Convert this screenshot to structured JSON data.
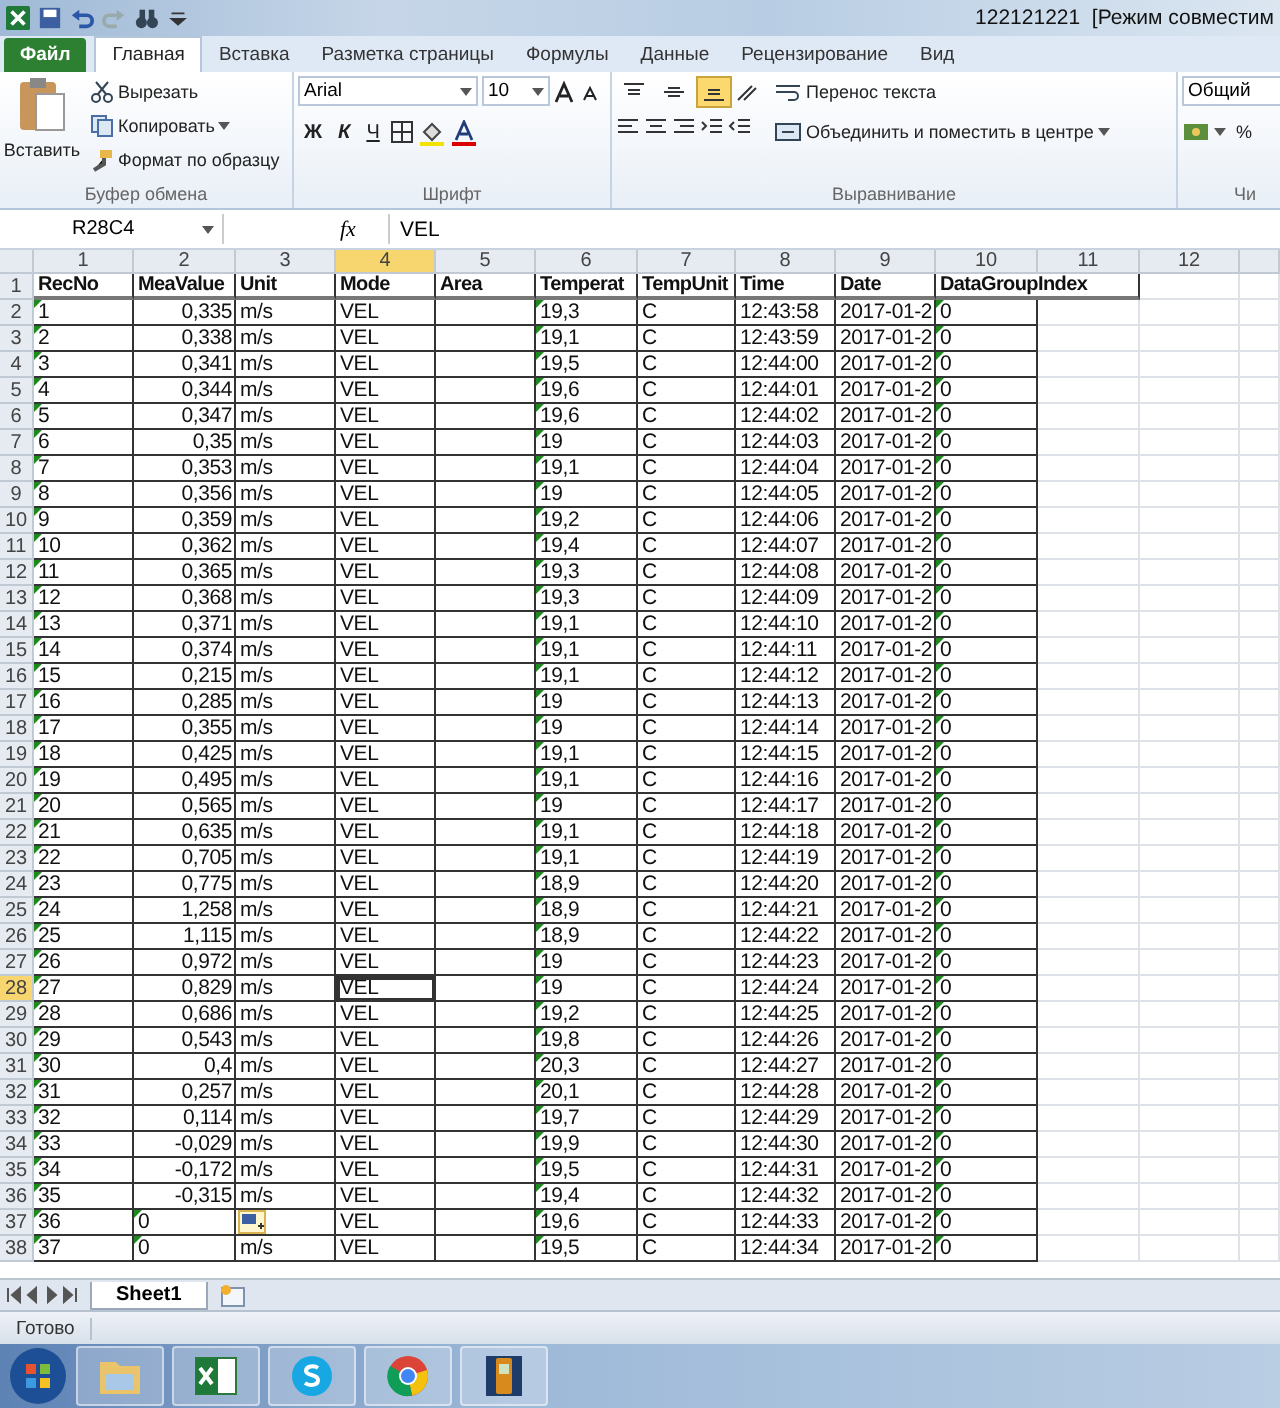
{
  "window": {
    "title": "122121221  [Режим совместим"
  },
  "ribbon_tabs": [
    {
      "label": "Файл",
      "kind": "file",
      "selected": false
    },
    {
      "label": "Главная",
      "kind": "tab",
      "selected": true
    },
    {
      "label": "Вставка",
      "kind": "tab",
      "selected": false
    },
    {
      "label": "Разметка страницы",
      "kind": "tab",
      "selected": false
    },
    {
      "label": "Формулы",
      "kind": "tab",
      "selected": false
    },
    {
      "label": "Данные",
      "kind": "tab",
      "selected": false
    },
    {
      "label": "Рецензирование",
      "kind": "tab",
      "selected": false
    },
    {
      "label": "Вид",
      "kind": "tab",
      "selected": false
    }
  ],
  "clipboard": {
    "paste": "Вставить",
    "cut": "Вырезать",
    "copy": "Копировать",
    "format_painter": "Формат по образцу",
    "label": "Буфер обмена"
  },
  "font": {
    "name": "Arial",
    "size": "10",
    "bold": "Ж",
    "italic": "К",
    "underline": "Ч",
    "label": "Шрифт"
  },
  "alignment": {
    "vertical": [
      {
        "selected": false
      },
      {
        "selected": false
      },
      {
        "selected": true
      }
    ],
    "wrap": "Перенос текста",
    "merge": "Объединить и поместить в центре",
    "label": "Выравнивание"
  },
  "number": {
    "format": "Общий",
    "percent": "%",
    "label": "Чи"
  },
  "formula_bar": {
    "name_box": "R28C4",
    "fx": "fx",
    "value": "VEL"
  },
  "columns": [
    {
      "label": "1",
      "selected": false
    },
    {
      "label": "2",
      "selected": false
    },
    {
      "label": "3",
      "selected": false
    },
    {
      "label": "4",
      "selected": true
    },
    {
      "label": "5",
      "selected": false
    },
    {
      "label": "6",
      "selected": false
    },
    {
      "label": "7",
      "selected": false
    },
    {
      "label": "8",
      "selected": false
    },
    {
      "label": "9",
      "selected": false
    },
    {
      "label": "10",
      "selected": false
    },
    {
      "label": "11",
      "selected": false
    },
    {
      "label": "12",
      "selected": false
    }
  ],
  "header_row": {
    "row_label": "1",
    "cells": [
      "RecNo",
      "MeaValue",
      "Unit",
      "Mode",
      "Area",
      "Temperat",
      "TempUnit",
      "Time",
      "Date",
      "DataGroupIndex"
    ]
  },
  "rows": [
    {
      "row_label": "2",
      "rec_no": "1",
      "mea_value": "0,335",
      "kind": "number",
      "unit": "m/s",
      "mode": "VEL",
      "temperature": "19,3",
      "temp_unit": "C",
      "time": "12:43:58",
      "date": "2017-01-2",
      "group_index": "0",
      "selected": false
    },
    {
      "row_label": "3",
      "rec_no": "2",
      "mea_value": "0,338",
      "kind": "number",
      "unit": "m/s",
      "mode": "VEL",
      "temperature": "19,1",
      "temp_unit": "C",
      "time": "12:43:59",
      "date": "2017-01-2",
      "group_index": "0",
      "selected": false
    },
    {
      "row_label": "4",
      "rec_no": "3",
      "mea_value": "0,341",
      "kind": "number",
      "unit": "m/s",
      "mode": "VEL",
      "temperature": "19,5",
      "temp_unit": "C",
      "time": "12:44:00",
      "date": "2017-01-2",
      "group_index": "0",
      "selected": false
    },
    {
      "row_label": "5",
      "rec_no": "4",
      "mea_value": "0,344",
      "kind": "number",
      "unit": "m/s",
      "mode": "VEL",
      "temperature": "19,6",
      "temp_unit": "C",
      "time": "12:44:01",
      "date": "2017-01-2",
      "group_index": "0",
      "selected": false
    },
    {
      "row_label": "6",
      "rec_no": "5",
      "mea_value": "0,347",
      "kind": "number",
      "unit": "m/s",
      "mode": "VEL",
      "temperature": "19,6",
      "temp_unit": "C",
      "time": "12:44:02",
      "date": "2017-01-2",
      "group_index": "0",
      "selected": false
    },
    {
      "row_label": "7",
      "rec_no": "6",
      "mea_value": "0,35",
      "kind": "number",
      "unit": "m/s",
      "mode": "VEL",
      "temperature": "19",
      "temp_unit": "C",
      "time": "12:44:03",
      "date": "2017-01-2",
      "group_index": "0",
      "selected": false
    },
    {
      "row_label": "8",
      "rec_no": "7",
      "mea_value": "0,353",
      "kind": "number",
      "unit": "m/s",
      "mode": "VEL",
      "temperature": "19,1",
      "temp_unit": "C",
      "time": "12:44:04",
      "date": "2017-01-2",
      "group_index": "0",
      "selected": false
    },
    {
      "row_label": "9",
      "rec_no": "8",
      "mea_value": "0,356",
      "kind": "number",
      "unit": "m/s",
      "mode": "VEL",
      "temperature": "19",
      "temp_unit": "C",
      "time": "12:44:05",
      "date": "2017-01-2",
      "group_index": "0",
      "selected": false
    },
    {
      "row_label": "10",
      "rec_no": "9",
      "mea_value": "0,359",
      "kind": "number",
      "unit": "m/s",
      "mode": "VEL",
      "temperature": "19,2",
      "temp_unit": "C",
      "time": "12:44:06",
      "date": "2017-01-2",
      "group_index": "0",
      "selected": false
    },
    {
      "row_label": "11",
      "rec_no": "10",
      "mea_value": "0,362",
      "kind": "number",
      "unit": "m/s",
      "mode": "VEL",
      "temperature": "19,4",
      "temp_unit": "C",
      "time": "12:44:07",
      "date": "2017-01-2",
      "group_index": "0",
      "selected": false
    },
    {
      "row_label": "12",
      "rec_no": "11",
      "mea_value": "0,365",
      "kind": "number",
      "unit": "m/s",
      "mode": "VEL",
      "temperature": "19,3",
      "temp_unit": "C",
      "time": "12:44:08",
      "date": "2017-01-2",
      "group_index": "0",
      "selected": false
    },
    {
      "row_label": "13",
      "rec_no": "12",
      "mea_value": "0,368",
      "kind": "number",
      "unit": "m/s",
      "mode": "VEL",
      "temperature": "19,3",
      "temp_unit": "C",
      "time": "12:44:09",
      "date": "2017-01-2",
      "group_index": "0",
      "selected": false
    },
    {
      "row_label": "14",
      "rec_no": "13",
      "mea_value": "0,371",
      "kind": "number",
      "unit": "m/s",
      "mode": "VEL",
      "temperature": "19,1",
      "temp_unit": "C",
      "time": "12:44:10",
      "date": "2017-01-2",
      "group_index": "0",
      "selected": false
    },
    {
      "row_label": "15",
      "rec_no": "14",
      "mea_value": "0,374",
      "kind": "number",
      "unit": "m/s",
      "mode": "VEL",
      "temperature": "19,1",
      "temp_unit": "C",
      "time": "12:44:11",
      "date": "2017-01-2",
      "group_index": "0",
      "selected": false
    },
    {
      "row_label": "16",
      "rec_no": "15",
      "mea_value": "0,215",
      "kind": "number",
      "unit": "m/s",
      "mode": "VEL",
      "temperature": "19,1",
      "temp_unit": "C",
      "time": "12:44:12",
      "date": "2017-01-2",
      "group_index": "0",
      "selected": false
    },
    {
      "row_label": "17",
      "rec_no": "16",
      "mea_value": "0,285",
      "kind": "number",
      "unit": "m/s",
      "mode": "VEL",
      "temperature": "19",
      "temp_unit": "C",
      "time": "12:44:13",
      "date": "2017-01-2",
      "group_index": "0",
      "selected": false
    },
    {
      "row_label": "18",
      "rec_no": "17",
      "mea_value": "0,355",
      "kind": "number",
      "unit": "m/s",
      "mode": "VEL",
      "temperature": "19",
      "temp_unit": "C",
      "time": "12:44:14",
      "date": "2017-01-2",
      "group_index": "0",
      "selected": false
    },
    {
      "row_label": "19",
      "rec_no": "18",
      "mea_value": "0,425",
      "kind": "number",
      "unit": "m/s",
      "mode": "VEL",
      "temperature": "19,1",
      "temp_unit": "C",
      "time": "12:44:15",
      "date": "2017-01-2",
      "group_index": "0",
      "selected": false
    },
    {
      "row_label": "20",
      "rec_no": "19",
      "mea_value": "0,495",
      "kind": "number",
      "unit": "m/s",
      "mode": "VEL",
      "temperature": "19,1",
      "temp_unit": "C",
      "time": "12:44:16",
      "date": "2017-01-2",
      "group_index": "0",
      "selected": false
    },
    {
      "row_label": "21",
      "rec_no": "20",
      "mea_value": "0,565",
      "kind": "number",
      "unit": "m/s",
      "mode": "VEL",
      "temperature": "19",
      "temp_unit": "C",
      "time": "12:44:17",
      "date": "2017-01-2",
      "group_index": "0",
      "selected": false
    },
    {
      "row_label": "22",
      "rec_no": "21",
      "mea_value": "0,635",
      "kind": "number",
      "unit": "m/s",
      "mode": "VEL",
      "temperature": "19,1",
      "temp_unit": "C",
      "time": "12:44:18",
      "date": "2017-01-2",
      "group_index": "0",
      "selected": false
    },
    {
      "row_label": "23",
      "rec_no": "22",
      "mea_value": "0,705",
      "kind": "number",
      "unit": "m/s",
      "mode": "VEL",
      "temperature": "19,1",
      "temp_unit": "C",
      "time": "12:44:19",
      "date": "2017-01-2",
      "group_index": "0",
      "selected": false
    },
    {
      "row_label": "24",
      "rec_no": "23",
      "mea_value": "0,775",
      "kind": "number",
      "unit": "m/s",
      "mode": "VEL",
      "temperature": "18,9",
      "temp_unit": "C",
      "time": "12:44:20",
      "date": "2017-01-2",
      "group_index": "0",
      "selected": false
    },
    {
      "row_label": "25",
      "rec_no": "24",
      "mea_value": "1,258",
      "kind": "number",
      "unit": "m/s",
      "mode": "VEL",
      "temperature": "18,9",
      "temp_unit": "C",
      "time": "12:44:21",
      "date": "2017-01-2",
      "group_index": "0",
      "selected": false
    },
    {
      "row_label": "26",
      "rec_no": "25",
      "mea_value": "1,115",
      "kind": "number",
      "unit": "m/s",
      "mode": "VEL",
      "temperature": "18,9",
      "temp_unit": "C",
      "time": "12:44:22",
      "date": "2017-01-2",
      "group_index": "0",
      "selected": false
    },
    {
      "row_label": "27",
      "rec_no": "26",
      "mea_value": "0,972",
      "kind": "number",
      "unit": "m/s",
      "mode": "VEL",
      "temperature": "19",
      "temp_unit": "C",
      "time": "12:44:23",
      "date": "2017-01-2",
      "group_index": "0",
      "selected": false
    },
    {
      "row_label": "28",
      "rec_no": "27",
      "mea_value": "0,829",
      "kind": "number",
      "unit": "m/s",
      "mode": "VEL",
      "temperature": "19",
      "temp_unit": "C",
      "time": "12:44:24",
      "date": "2017-01-2",
      "group_index": "0",
      "selected": true
    },
    {
      "row_label": "29",
      "rec_no": "28",
      "mea_value": "0,686",
      "kind": "number",
      "unit": "m/s",
      "mode": "VEL",
      "temperature": "19,2",
      "temp_unit": "C",
      "time": "12:44:25",
      "date": "2017-01-2",
      "group_index": "0",
      "selected": false
    },
    {
      "row_label": "30",
      "rec_no": "29",
      "mea_value": "0,543",
      "kind": "number",
      "unit": "m/s",
      "mode": "VEL",
      "temperature": "19,8",
      "temp_unit": "C",
      "time": "12:44:26",
      "date": "2017-01-2",
      "group_index": "0",
      "selected": false
    },
    {
      "row_label": "31",
      "rec_no": "30",
      "mea_value": "0,4",
      "kind": "number",
      "unit": "m/s",
      "mode": "VEL",
      "temperature": "20,3",
      "temp_unit": "C",
      "time": "12:44:27",
      "date": "2017-01-2",
      "group_index": "0",
      "selected": false
    },
    {
      "row_label": "32",
      "rec_no": "31",
      "mea_value": "0,257",
      "kind": "number",
      "unit": "m/s",
      "mode": "VEL",
      "temperature": "20,1",
      "temp_unit": "C",
      "time": "12:44:28",
      "date": "2017-01-2",
      "group_index": "0",
      "selected": false
    },
    {
      "row_label": "33",
      "rec_no": "32",
      "mea_value": "0,114",
      "kind": "number",
      "unit": "m/s",
      "mode": "VEL",
      "temperature": "19,7",
      "temp_unit": "C",
      "time": "12:44:29",
      "date": "2017-01-2",
      "group_index": "0",
      "selected": false
    },
    {
      "row_label": "34",
      "rec_no": "33",
      "mea_value": "-0,029",
      "kind": "number",
      "unit": "m/s",
      "mode": "VEL",
      "temperature": "19,9",
      "temp_unit": "C",
      "time": "12:44:30",
      "date": "2017-01-2",
      "group_index": "0",
      "selected": false
    },
    {
      "row_label": "35",
      "rec_no": "34",
      "mea_value": "-0,172",
      "kind": "number",
      "unit": "m/s",
      "mode": "VEL",
      "temperature": "19,5",
      "temp_unit": "C",
      "time": "12:44:31",
      "date": "2017-01-2",
      "group_index": "0",
      "selected": false
    },
    {
      "row_label": "36",
      "rec_no": "35",
      "mea_value": "-0,315",
      "kind": "number",
      "unit": "m/s",
      "mode": "VEL",
      "temperature": "19,4",
      "temp_unit": "C",
      "time": "12:44:32",
      "date": "2017-01-2",
      "group_index": "0",
      "selected": false
    },
    {
      "row_label": "37",
      "rec_no": "36",
      "mea_value": "0",
      "kind": "text",
      "mode": "VEL",
      "temperature": "19,6",
      "temp_unit": "C",
      "time": "12:44:33",
      "date": "2017-01-2",
      "group_index": "0",
      "selected": false
    },
    {
      "row_label": "38",
      "rec_no": "37",
      "mea_value": "0",
      "kind": "text",
      "unit": "m/s",
      "mode": "VEL",
      "temperature": "19,5",
      "temp_unit": "C",
      "time": "12:44:34",
      "date": "2017-01-2",
      "group_index": "0",
      "selected": false
    }
  ],
  "sheet_tabs": [
    {
      "label": "Sheet1",
      "selected": true
    }
  ],
  "status_bar": {
    "text": "Готово"
  }
}
